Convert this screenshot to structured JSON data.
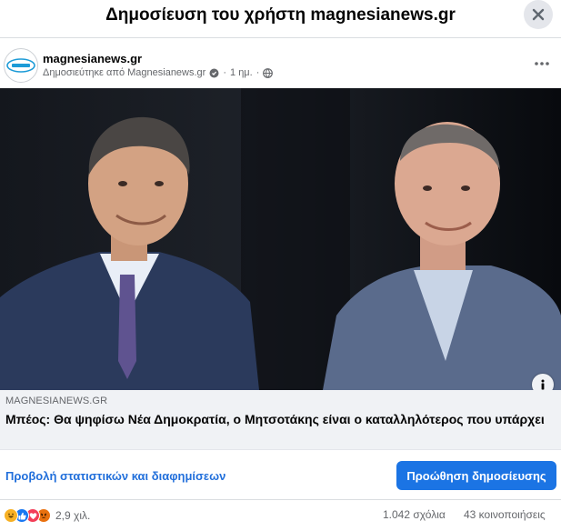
{
  "dialog": {
    "title": "Δημοσίευση του χρήστη magnesianews.gr"
  },
  "post": {
    "page_name": "magnesianews.gr",
    "published_by": "Δημοσιεύτηκε από Magnesianews.gr",
    "time": "1 ημ.",
    "separator": "·"
  },
  "link_preview": {
    "domain": "MAGNESIANEWS.GR",
    "headline": "Μπέος: Θα ψηφίσω Νέα Δημοκρατία, ο Μητσοτάκης είναι ο καταλληλότερος που υπάρχει"
  },
  "actions": {
    "insights_label": "Προβολή στατιστικών και διαφημίσεων",
    "boost_label": "Προώθηση δημοσίευσης"
  },
  "stats": {
    "reactions_count": "2,9 χιλ.",
    "comments": "1.042 σχόλια",
    "shares": "43 κοινοποιήσεις",
    "reaction_types": [
      "haha",
      "like",
      "love",
      "angry"
    ]
  },
  "colors": {
    "accent": "#1b74e4",
    "link": "#216fdb",
    "secondary_text": "#65676b",
    "card_bg": "#f0f2f5",
    "like": "#1877f2",
    "love": "#f33e58",
    "haha": "#f7b125",
    "angry": "#e9710f"
  },
  "icons": {
    "close": "close-icon",
    "more": "more-horizontal-icon",
    "globe": "globe-icon",
    "badge": "page-badge-icon",
    "info": "info-icon"
  }
}
